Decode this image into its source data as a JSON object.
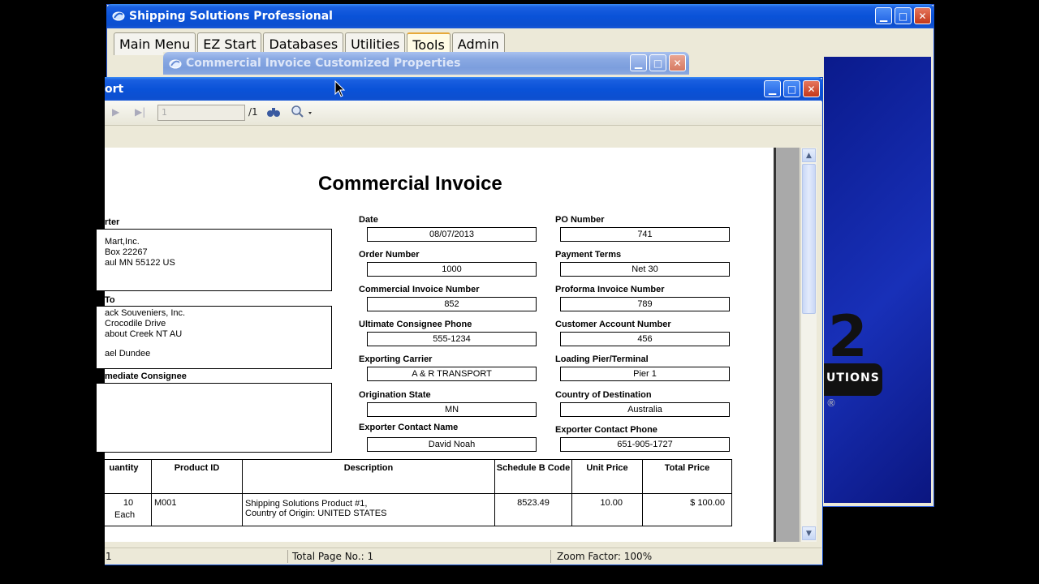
{
  "main_window": {
    "title": "Shipping Solutions Professional",
    "tabs": [
      "Main Menu",
      "EZ Start",
      "Databases",
      "Utilities",
      "Tools",
      "Admin"
    ],
    "active_tab": "Tools",
    "logo_fragment": "UTIONS",
    "logo_numeral": "2",
    "logo_reg": "®"
  },
  "props_window": {
    "title": "Commercial Invoice Customized Properties"
  },
  "report_window": {
    "title": "ort",
    "toolbar": {
      "page_value": "1",
      "page_total": "/1"
    },
    "status": {
      "page": "1",
      "total_pages": "Total Page No.: 1",
      "zoom": "Zoom Factor: 100%"
    }
  },
  "invoice": {
    "title": "Commercial Invoice",
    "exporter_label": "rter",
    "exporter_lines": [
      "Mart,Inc.",
      "Box 22267",
      "aul MN  55122 US"
    ],
    "shipto_label": "To",
    "shipto_lines": [
      "ack Souveniers, Inc.",
      "Crocodile Drive",
      "about Creek NT  AU",
      "",
      "ael Dundee"
    ],
    "intermediate_label": "mediate Consignee",
    "fields": [
      {
        "label": "Date",
        "value": "08/07/2013"
      },
      {
        "label": "PO Number",
        "value": "741"
      },
      {
        "label": "Order Number",
        "value": "1000"
      },
      {
        "label": "Payment Terms",
        "value": "Net 30"
      },
      {
        "label": "Commercial Invoice Number",
        "value": "852"
      },
      {
        "label": "Proforma Invoice Number",
        "value": "789"
      },
      {
        "label": "Ultimate Consignee Phone",
        "value": "555-1234"
      },
      {
        "label": "Customer Account Number",
        "value": "456"
      },
      {
        "label": "Exporting Carrier",
        "value": "A &  R TRANSPORT"
      },
      {
        "label": "Loading Pier/Terminal",
        "value": "Pier 1"
      },
      {
        "label": "Origination State",
        "value": "MN"
      },
      {
        "label": "Country of Destination",
        "value": "Australia"
      },
      {
        "label": "Exporter Contact Name",
        "value": "David Noah"
      },
      {
        "label": "Exporter Contact Phone",
        "value": "651-905-1727"
      }
    ],
    "table": {
      "headers": [
        "uantity",
        "Product ID",
        "Description",
        "Schedule B Code",
        "Unit Price",
        "Total Price"
      ],
      "rows": [
        {
          "qty": "10",
          "unit": "Each",
          "product_id": "M001",
          "desc1": "Shipping Solutions Product #1,",
          "desc2": "Country of Origin: UNITED STATES",
          "schedb": "8523.49",
          "unit_price": "10.00",
          "total": "$ 100.00"
        }
      ]
    }
  }
}
